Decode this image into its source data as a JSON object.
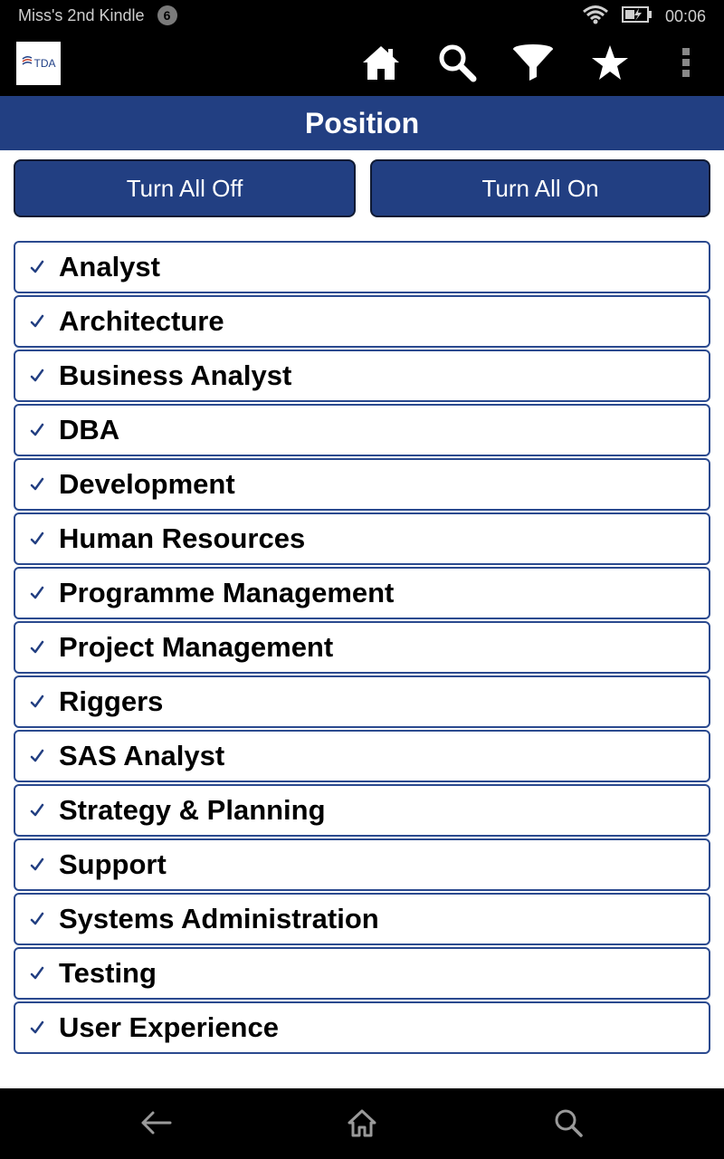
{
  "status_bar": {
    "device_name": "Miss's 2nd Kindle",
    "notification_count": "6",
    "time": "00:06",
    "icons": [
      "wifi-icon",
      "battery-charging-icon"
    ]
  },
  "action_bar": {
    "logo_text": "TDA",
    "actions": [
      "home-icon",
      "search-icon",
      "filter-icon",
      "star-icon",
      "overflow-menu-icon"
    ]
  },
  "page": {
    "title": "Position"
  },
  "buttons": {
    "turn_all_off": "Turn All Off",
    "turn_all_on": "Turn All On"
  },
  "positions": [
    {
      "label": "Analyst",
      "checked": true
    },
    {
      "label": "Architecture",
      "checked": true
    },
    {
      "label": "Business Analyst",
      "checked": true
    },
    {
      "label": "DBA",
      "checked": true
    },
    {
      "label": "Development",
      "checked": true
    },
    {
      "label": "Human Resources",
      "checked": true
    },
    {
      "label": "Programme Management",
      "checked": true
    },
    {
      "label": "Project Management",
      "checked": true
    },
    {
      "label": "Riggers",
      "checked": true
    },
    {
      "label": "SAS Analyst",
      "checked": true
    },
    {
      "label": "Strategy & Planning",
      "checked": true
    },
    {
      "label": "Support",
      "checked": true
    },
    {
      "label": "Systems Administration",
      "checked": true
    },
    {
      "label": "Testing",
      "checked": true
    },
    {
      "label": "User Experience",
      "checked": true
    }
  ],
  "nav_bar": {
    "icons": [
      "back-icon",
      "home-icon",
      "search-icon"
    ]
  },
  "colors": {
    "brand_blue": "#223f82",
    "border_blue": "#2b4a8f"
  }
}
